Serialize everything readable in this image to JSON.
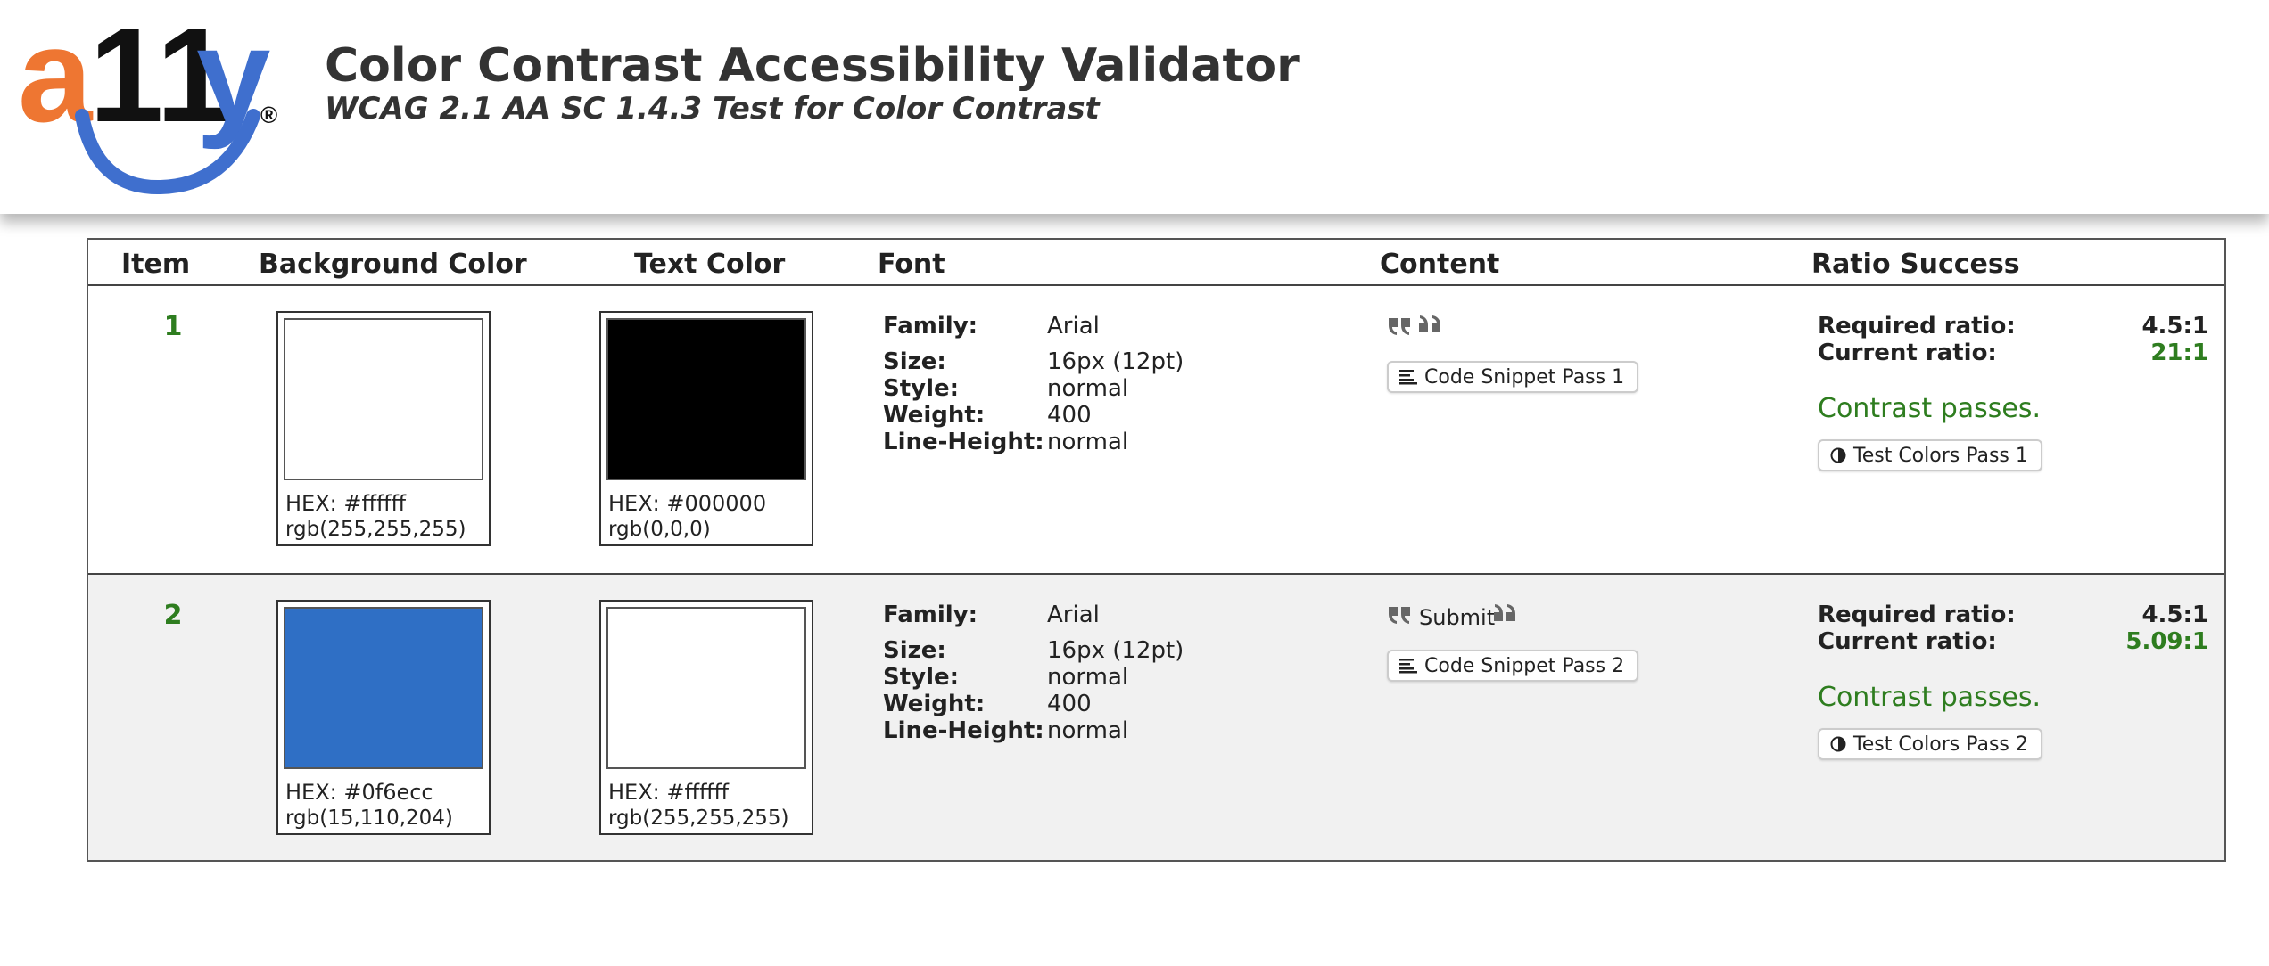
{
  "header": {
    "logo_text": "a11y®",
    "title": "Color Contrast Accessibility Validator",
    "subtitle": "WCAG 2.1 AA SC 1.4.3 Test for Color Contrast"
  },
  "table": {
    "headers": [
      "Item",
      "Background Color",
      "Text Color",
      "Font",
      "Content",
      "Ratio Success"
    ],
    "rows": [
      {
        "item": "1",
        "bg": {
          "hex_label": "HEX:  #ffffff",
          "rgb": "rgb(255,255,255)",
          "color": "#ffffff"
        },
        "fg": {
          "hex_label": "HEX:  #000000",
          "rgb": "rgb(0,0,0)",
          "color": "#000000"
        },
        "font": {
          "family_label": "Family:",
          "family": "Arial",
          "size_label": "Size:",
          "size": "16px (12pt)",
          "style_label": "Style:",
          "style": "normal",
          "weight_label": "Weight:",
          "weight": "400",
          "lineheight_label": "Line-Height:",
          "lineheight": "normal"
        },
        "content": {
          "text": "",
          "snippet_button": "Code Snippet Pass 1"
        },
        "ratio": {
          "required_label": "Required ratio:",
          "required": "4.5:1",
          "current_label": "Current ratio:",
          "current": "21:1",
          "status": "Contrast passes.",
          "test_button": "Test Colors Pass 1"
        }
      },
      {
        "item": "2",
        "bg": {
          "hex_label": "HEX:  #0f6ecc",
          "rgb": "rgb(15,110,204)",
          "color": "#2f6fc5"
        },
        "fg": {
          "hex_label": "HEX:  #ffffff",
          "rgb": "rgb(255,255,255)",
          "color": "#ffffff"
        },
        "font": {
          "family_label": "Family:",
          "family": "Arial",
          "size_label": "Size:",
          "size": "16px (12pt)",
          "style_label": "Style:",
          "style": "normal",
          "weight_label": "Weight:",
          "weight": "400",
          "lineheight_label": "Line-Height:",
          "lineheight": "normal"
        },
        "content": {
          "text": "Submit",
          "snippet_button": "Code Snippet Pass 2"
        },
        "ratio": {
          "required_label": "Required ratio:",
          "required": "4.5:1",
          "current_label": "Current ratio:",
          "current": "5.09:1",
          "status": "Contrast passes.",
          "test_button": "Test Colors Pass 2"
        }
      }
    ]
  },
  "colors": {
    "logo_orange": "#ee7632",
    "logo_blue": "#3f6fce",
    "pass_green": "#2e7d1f"
  }
}
